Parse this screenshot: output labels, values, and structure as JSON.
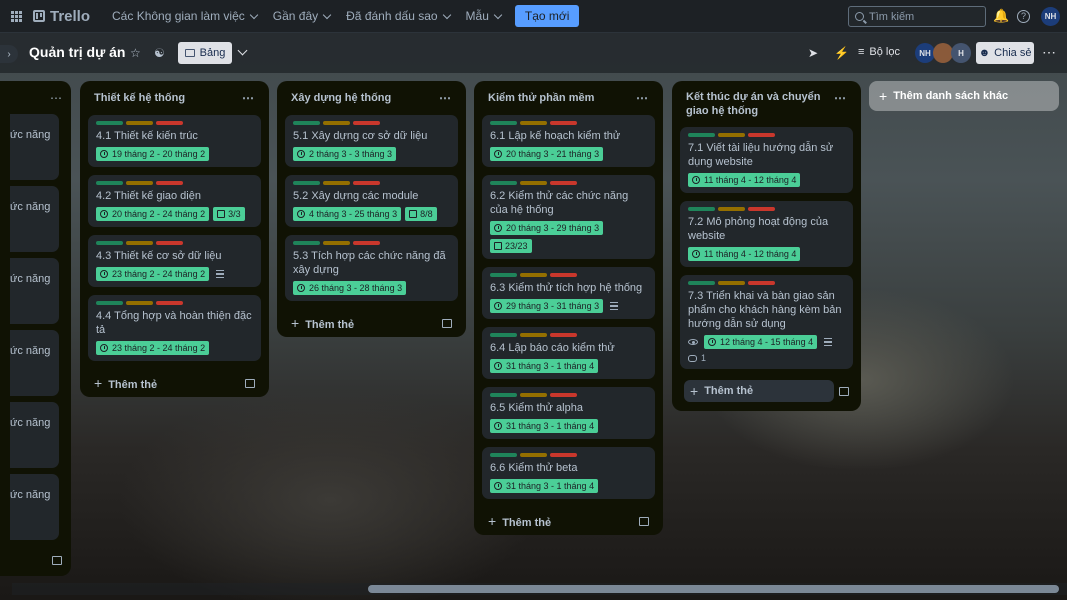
{
  "nav": {
    "logo": "Trello",
    "items": [
      "Các Không gian làm việc",
      "Gần đây",
      "Đã đánh dấu sao",
      "Mẫu"
    ],
    "create": "Tạo mới",
    "search_placeholder": "Tìm kiếm",
    "user_initials": "NH"
  },
  "board": {
    "title": "Quản trị dự án",
    "view_label": "Bảng",
    "filter_label": "Bộ lọc",
    "share_label": "Chia sẻ",
    "members": [
      "NH",
      "",
      "H"
    ]
  },
  "partial_list": {
    "card_text": "ức năng"
  },
  "lists": [
    {
      "title": "Thiết kế hệ thống",
      "cards": [
        {
          "title": "4.1 Thiết kế kiến trúc",
          "due": "19 tháng 2 - 20 tháng 2"
        },
        {
          "title": "4.2 Thiết kế giao diện",
          "due": "20 tháng 2 - 24 tháng 2",
          "checklist": "3/3"
        },
        {
          "title": "4.3 Thiết kế cơ sở dữ liệu",
          "due": "23 tháng 2 - 24 tháng 2",
          "description": true
        },
        {
          "title": "4.4 Tổng hợp và hoàn thiện đặc tả",
          "due": "23 tháng 2 - 24 tháng 2"
        }
      ],
      "add_label": "Thêm thẻ"
    },
    {
      "title": "Xây dựng hệ thống",
      "cards": [
        {
          "title": "5.1 Xây dựng cơ sở dữ liệu",
          "due": "2 tháng 3 - 3 tháng 3"
        },
        {
          "title": "5.2 Xây dựng các module",
          "due": "4 tháng 3 - 25 tháng 3",
          "checklist": "8/8"
        },
        {
          "title": "5.3 Tích hợp các chức năng đã xây dựng",
          "due": "26 tháng 3 - 28 tháng 3"
        }
      ],
      "add_label": "Thêm thẻ"
    },
    {
      "title": "Kiểm thử phần mềm",
      "cards": [
        {
          "title": "6.1 Lập kế hoạch kiểm thử",
          "due": "20 tháng 3 - 21 tháng 3"
        },
        {
          "title": "6.2 Kiểm thử các chức năng của hệ thống",
          "due": "20 tháng 3 - 29 tháng 3",
          "checklist": "23/23"
        },
        {
          "title": "6.3 Kiểm thử tích hợp hệ thống",
          "due": "29 tháng 3 - 31 tháng 3",
          "description": true
        },
        {
          "title": "6.4 Lập báo cáo kiểm thử",
          "due": "31 tháng 3 - 1 tháng 4"
        },
        {
          "title": "6.5 Kiểm thử alpha",
          "due": "31 tháng 3 - 1 tháng 4"
        },
        {
          "title": "6.6 Kiểm thử beta",
          "due": "31 tháng 3 - 1 tháng 4"
        }
      ],
      "add_label": "Thêm thẻ"
    },
    {
      "title": "Kết thúc dự án và chuyển giao hệ thống",
      "cards": [
        {
          "title": "7.1 Viết tài liệu hướng dẫn sử dụng website",
          "due": "11 tháng 4 - 12 tháng 4"
        },
        {
          "title": "7.2 Mô phỏng hoạt động của website",
          "due": "11 tháng 4 - 12 tháng 4"
        },
        {
          "title": "7.3 Triển khai và bàn giao sản phẩm cho khách hàng kèm bản hướng dẫn sử dụng",
          "due": "12 tháng 4 - 15 tháng 4",
          "watch": true,
          "description": true,
          "comments": "1"
        }
      ],
      "add_label": "Thêm thẻ"
    }
  ],
  "add_list_label": "Thêm danh sách khác",
  "colors": {
    "label_green": "#1f845a",
    "label_yellow": "#946f00",
    "label_red": "#c9372c",
    "due_badge": "#4bce97",
    "create_button": "#579dff",
    "list_bg": "#101204",
    "card_bg": "#22272b"
  }
}
